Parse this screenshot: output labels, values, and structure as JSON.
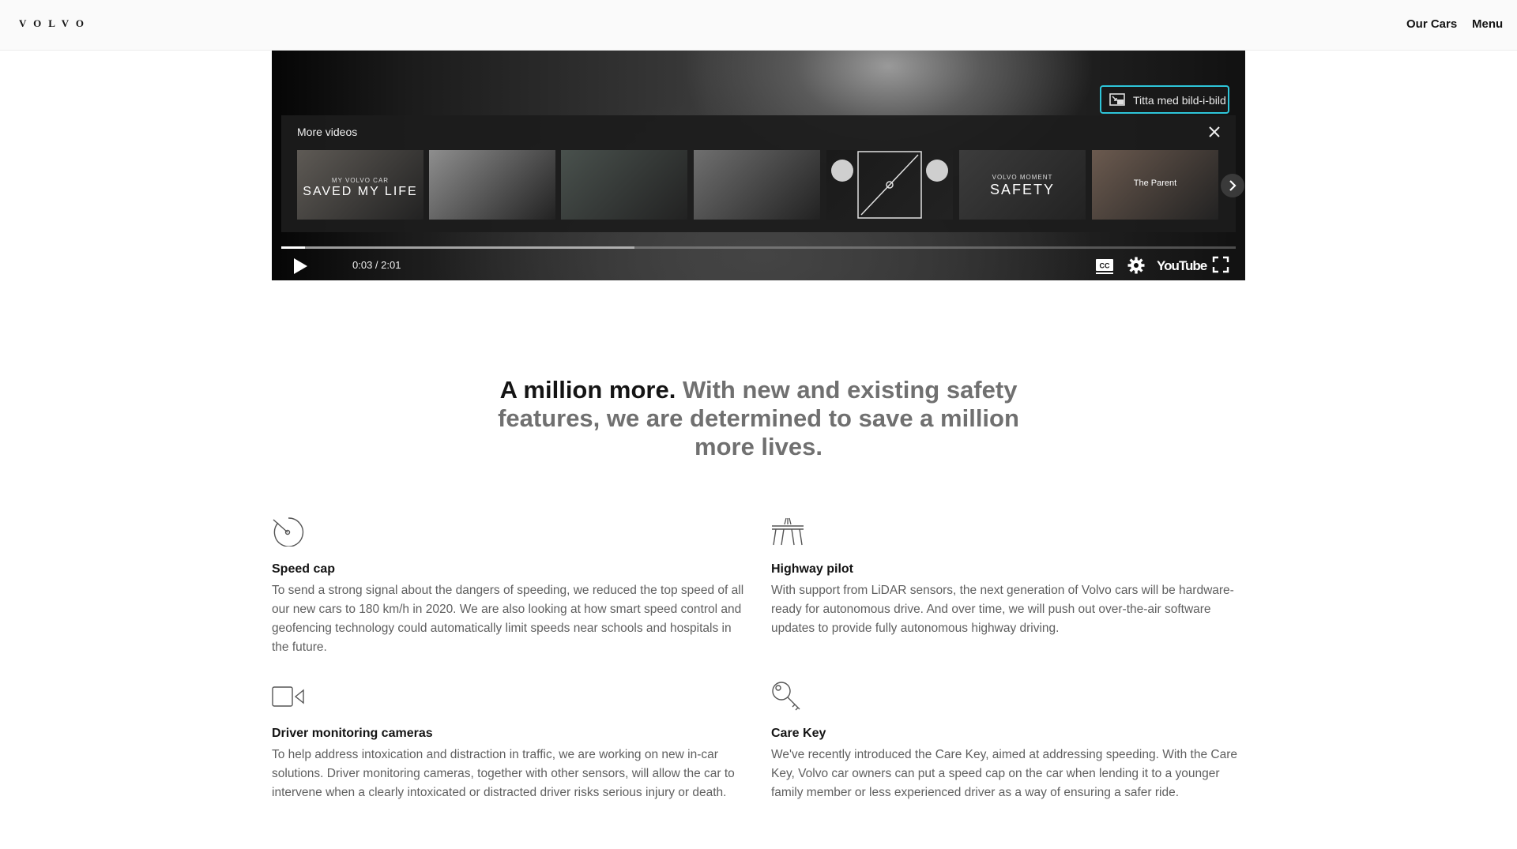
{
  "header": {
    "logo": "VOLVO",
    "nav": [
      "Our Cars",
      "Menu"
    ]
  },
  "video": {
    "pip_label": "Titta med bild-i-bild",
    "more_videos_title": "More videos",
    "thumbnails": [
      {
        "caption_small": "MY VOLVO CAR",
        "caption_big": "SAVED MY LIFE",
        "tone": "#5e5a55"
      },
      {
        "caption_small": "",
        "caption_big": "",
        "tone": "#8e8e8e"
      },
      {
        "caption_small": "",
        "caption_big": "",
        "tone": "#49514d"
      },
      {
        "caption_small": "",
        "caption_big": "",
        "tone": "#6f6f6f"
      },
      {
        "caption_small": "",
        "caption_big": "",
        "tone": "#1a1a1a"
      },
      {
        "caption_small": "VOLVO MOMENT",
        "caption_big": "SAFETY",
        "tone": "#3c3c3c"
      },
      {
        "caption_small": "",
        "caption_big": "The Parent",
        "tone": "#6b5a4f"
      }
    ],
    "time": "0:03 / 2:01",
    "played_fraction": 0.025,
    "buffered_fraction": 0.37,
    "brand": "YouTube"
  },
  "headline": {
    "strong": "A million more.",
    "light": "With new and existing safety features, we are determined to save a million more lives."
  },
  "features": [
    {
      "icon": "speedometer-icon",
      "title": "Speed cap",
      "body": "To send a strong signal about the dangers of speeding, we reduced the top speed of all our new cars to 180 km/h in 2020. We are also looking at how smart speed control and geofencing technology could automatically limit speeds near schools and hospitals in the future."
    },
    {
      "icon": "highway-icon",
      "title": "Highway pilot",
      "body": "With support from LiDAR sensors, the next generation of Volvo cars will be hardware-ready for autonomous drive. And over time, we will push out over-the-air software updates to provide fully autonomous highway driving."
    },
    {
      "icon": "camera-icon",
      "title": "Driver monitoring cameras",
      "body": "To help address intoxication and distraction in traffic, we are working on new in-car solutions. Driver monitoring cameras, together with other sensors, will allow the car to intervene when a clearly intoxicated or distracted driver risks serious injury or death."
    },
    {
      "icon": "key-icon",
      "title": "Care Key",
      "body": "We've recently introduced the Care Key, aimed at addressing speeding. With the Care Key, Volvo car owners can put a speed cap on the car when lending it to a younger family member or less experienced driver as a way of ensuring a safer ride."
    }
  ]
}
